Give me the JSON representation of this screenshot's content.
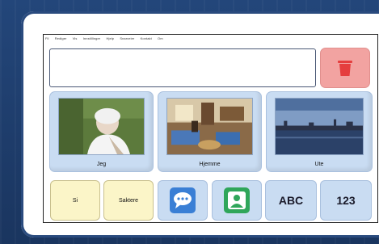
{
  "menu": {
    "items": [
      "Fil",
      "Rediger",
      "Vis",
      "Innstillinger",
      "Hjelp",
      "Snarveier",
      "Kontakt",
      "Om"
    ]
  },
  "message_bar": {
    "value": ""
  },
  "clear_button": {
    "icon": "trash-icon",
    "color": "#e53e3e"
  },
  "tiles": [
    {
      "label": "Jeg",
      "image": "elderly-woman-photo"
    },
    {
      "label": "Hjemme",
      "image": "living-room-photo"
    },
    {
      "label": "Ute",
      "image": "city-waterfront-photo"
    }
  ],
  "bottom_row": {
    "yes_label": "Si",
    "more_label": "Saktere",
    "chat_icon": "speech-bubble-icon",
    "contact_icon": "person-icon",
    "abc_label": "ABC",
    "num_label": "123"
  },
  "colors": {
    "tile": "#c9dcf2",
    "yellow": "#fbf5c8",
    "red": "#f2a3a1",
    "chat_blue": "#3a7fd5",
    "contact_green": "#2fa65a"
  }
}
